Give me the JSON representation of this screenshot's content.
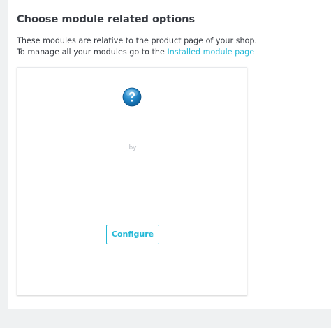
{
  "section": {
    "title": "Choose module related options",
    "description_line1": "These modules are relative to the product page of your shop.",
    "description_line2_prefix": "To manage all your modules go to the ",
    "installed_link_label": "Installed module page"
  },
  "module_card": {
    "icon": "question-mark-icon",
    "by_label": "by",
    "configure_label": "Configure"
  },
  "colors": {
    "accent": "#25b9d7",
    "icon_blue": "#1a77b5",
    "text": "#363a41",
    "background": "#eff1f2"
  }
}
